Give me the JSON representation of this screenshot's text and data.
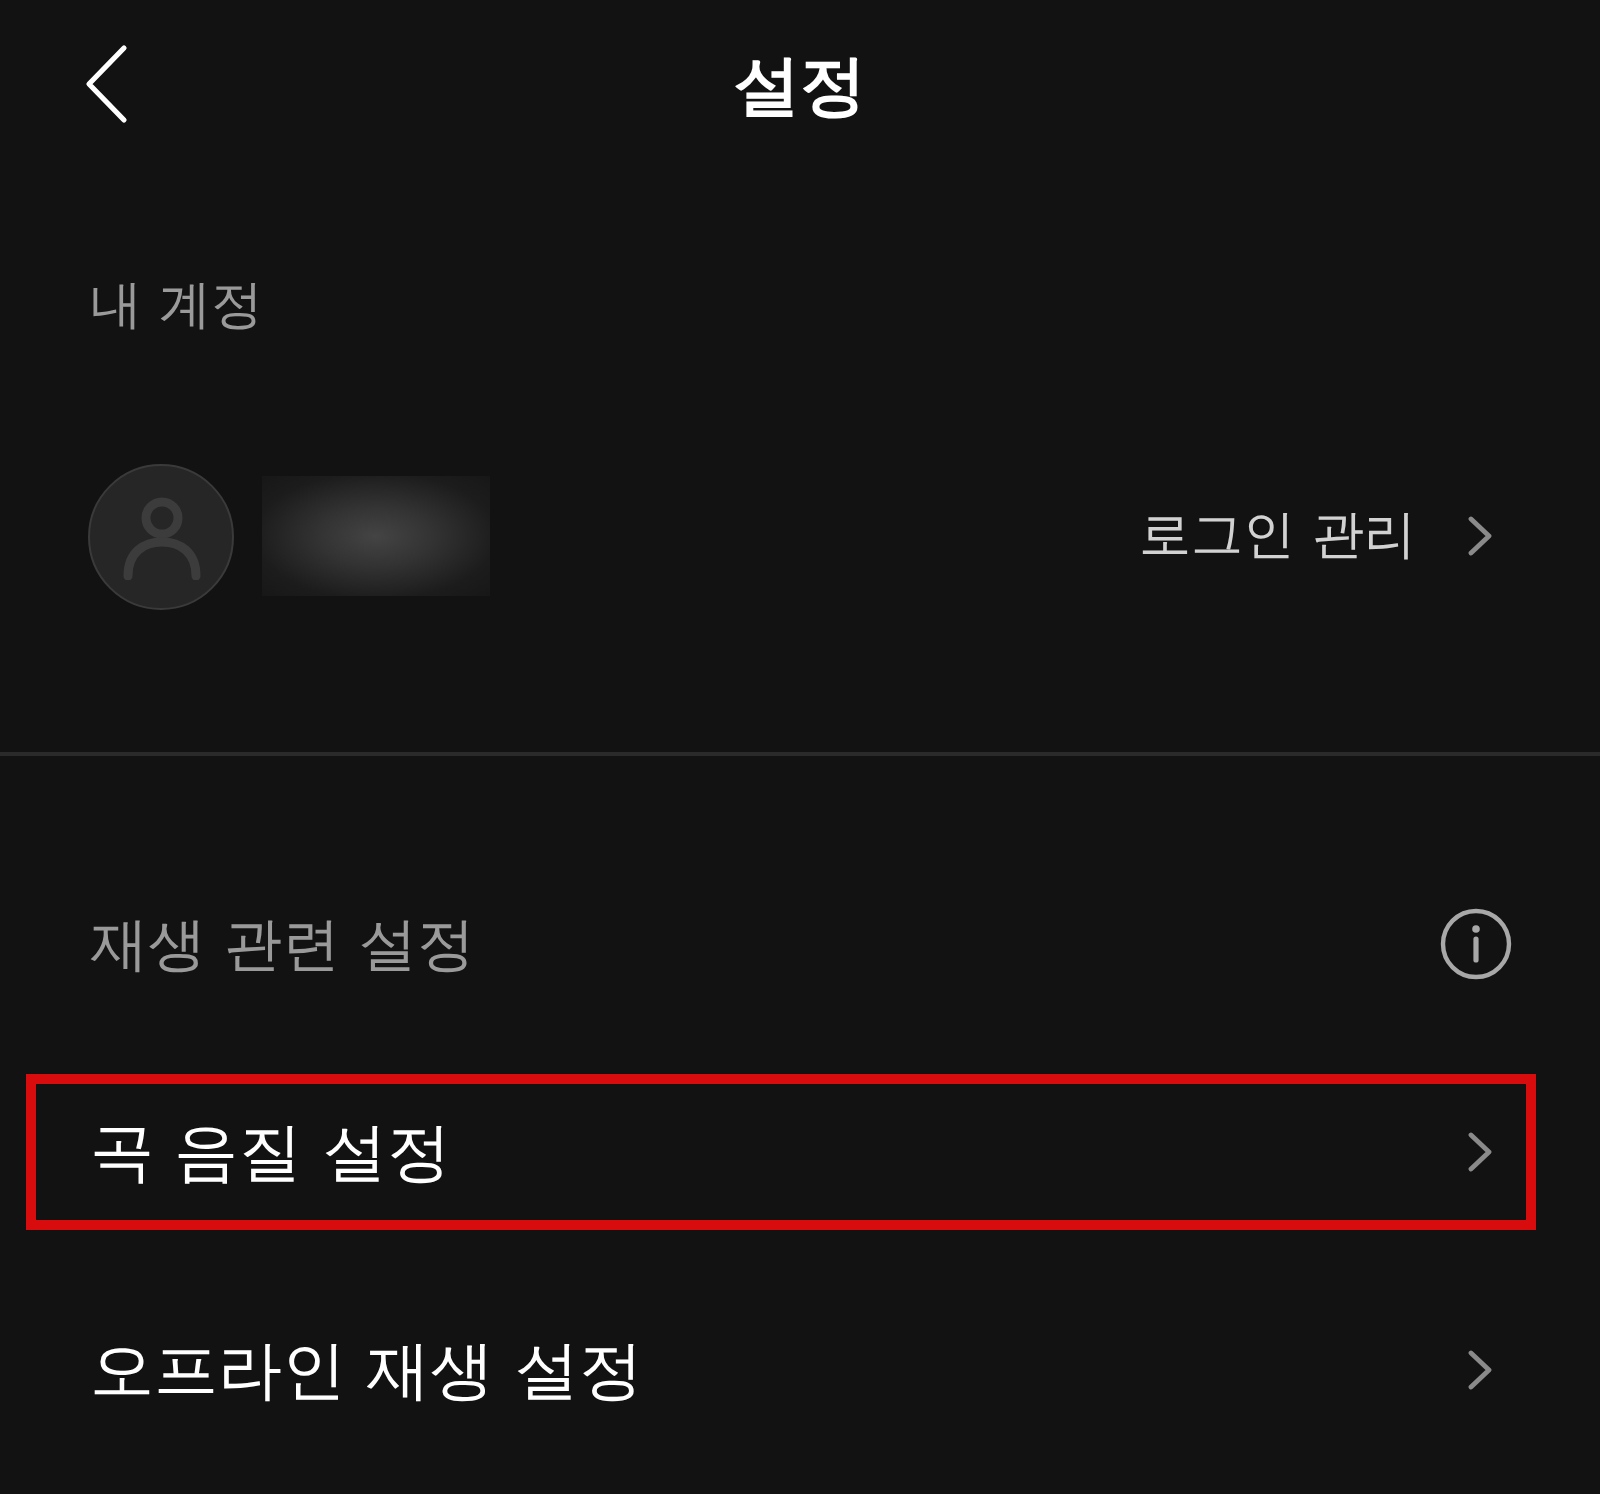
{
  "header": {
    "title": "설정"
  },
  "account": {
    "heading": "내 계정",
    "login_link": "로그인 관리"
  },
  "playback": {
    "heading": "재생 관련 설정",
    "items": [
      {
        "label": "곡 음질 설정",
        "highlighted": true
      },
      {
        "label": "오프라인 재생 설정",
        "highlighted": false
      }
    ]
  }
}
